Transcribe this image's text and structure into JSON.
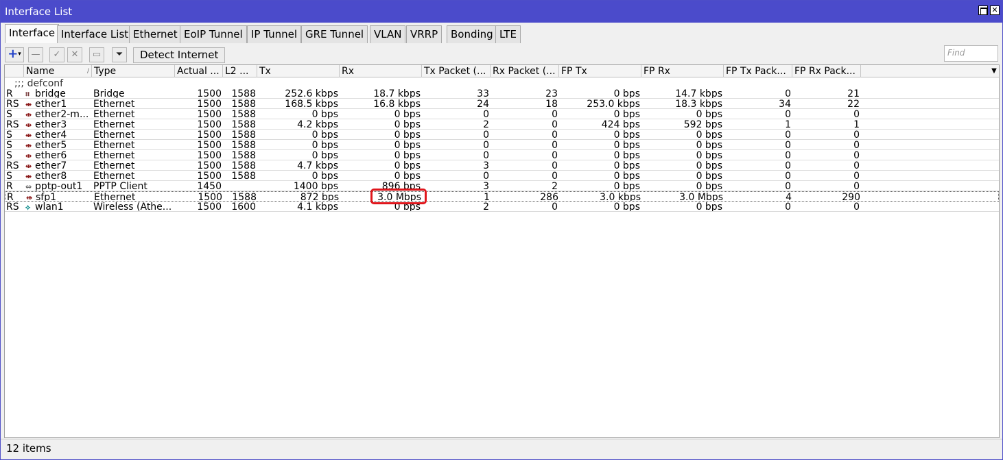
{
  "window": {
    "title": "Interface List"
  },
  "tabs": [
    "Interface",
    "Interface List",
    "Ethernet",
    "EoIP Tunnel",
    "IP Tunnel",
    "GRE Tunnel",
    "VLAN",
    "VRRP",
    "Bonding",
    "LTE"
  ],
  "toolbar": {
    "add_icon": "plus-icon",
    "remove_icon": "minus-icon",
    "enable_icon": "check-icon",
    "disable_icon": "x-icon",
    "comment_icon": "note-icon",
    "filter_icon": "funnel-icon",
    "detect_label": "Detect Internet",
    "find_placeholder": "Find"
  },
  "columns": [
    "Name",
    "Type",
    "Actual ...",
    "L2 ...",
    "Tx",
    "Rx",
    "Tx Packet (...",
    "Rx Packet (...",
    "FP Tx",
    "FP Rx",
    "FP Tx Pack...",
    "FP Rx Pack..."
  ],
  "comment_row": ";;; defconf",
  "rows": [
    {
      "flags": "R",
      "icon": "bridge-icon",
      "name": "bridge",
      "type": "Bridge",
      "actual": "1500",
      "l2": "1588",
      "tx": "252.6 kbps",
      "rx": "18.7 kbps",
      "txp": "33",
      "rxp": "23",
      "fptx": "0 bps",
      "fprx": "14.7 kbps",
      "fptxp": "0",
      "fprxp": "21"
    },
    {
      "flags": "RS",
      "icon": "ethernet-icon",
      "name": "ether1",
      "type": "Ethernet",
      "actual": "1500",
      "l2": "1588",
      "tx": "168.5 kbps",
      "rx": "16.8 kbps",
      "txp": "24",
      "rxp": "18",
      "fptx": "253.0 kbps",
      "fprx": "18.3 kbps",
      "fptxp": "34",
      "fprxp": "22"
    },
    {
      "flags": "S",
      "icon": "ethernet-icon",
      "name": "ether2-m...",
      "type": "Ethernet",
      "actual": "1500",
      "l2": "1588",
      "tx": "0 bps",
      "rx": "0 bps",
      "txp": "0",
      "rxp": "0",
      "fptx": "0 bps",
      "fprx": "0 bps",
      "fptxp": "0",
      "fprxp": "0"
    },
    {
      "flags": "RS",
      "icon": "ethernet-icon",
      "name": "ether3",
      "type": "Ethernet",
      "actual": "1500",
      "l2": "1588",
      "tx": "4.2 kbps",
      "rx": "0 bps",
      "txp": "2",
      "rxp": "0",
      "fptx": "424 bps",
      "fprx": "592 bps",
      "fptxp": "1",
      "fprxp": "1"
    },
    {
      "flags": "S",
      "icon": "ethernet-icon",
      "name": "ether4",
      "type": "Ethernet",
      "actual": "1500",
      "l2": "1588",
      "tx": "0 bps",
      "rx": "0 bps",
      "txp": "0",
      "rxp": "0",
      "fptx": "0 bps",
      "fprx": "0 bps",
      "fptxp": "0",
      "fprxp": "0"
    },
    {
      "flags": "S",
      "icon": "ethernet-icon",
      "name": "ether5",
      "type": "Ethernet",
      "actual": "1500",
      "l2": "1588",
      "tx": "0 bps",
      "rx": "0 bps",
      "txp": "0",
      "rxp": "0",
      "fptx": "0 bps",
      "fprx": "0 bps",
      "fptxp": "0",
      "fprxp": "0"
    },
    {
      "flags": "S",
      "icon": "ethernet-icon",
      "name": "ether6",
      "type": "Ethernet",
      "actual": "1500",
      "l2": "1588",
      "tx": "0 bps",
      "rx": "0 bps",
      "txp": "0",
      "rxp": "0",
      "fptx": "0 bps",
      "fprx": "0 bps",
      "fptxp": "0",
      "fprxp": "0"
    },
    {
      "flags": "RS",
      "icon": "ethernet-icon",
      "name": "ether7",
      "type": "Ethernet",
      "actual": "1500",
      "l2": "1588",
      "tx": "4.7 kbps",
      "rx": "0 bps",
      "txp": "3",
      "rxp": "0",
      "fptx": "0 bps",
      "fprx": "0 bps",
      "fptxp": "0",
      "fprxp": "0"
    },
    {
      "flags": "S",
      "icon": "ethernet-icon",
      "name": "ether8",
      "type": "Ethernet",
      "actual": "1500",
      "l2": "1588",
      "tx": "0 bps",
      "rx": "0 bps",
      "txp": "0",
      "rxp": "0",
      "fptx": "0 bps",
      "fprx": "0 bps",
      "fptxp": "0",
      "fprxp": "0"
    },
    {
      "flags": "R",
      "icon": "pptp-icon",
      "name": "pptp-out1",
      "type": "PPTP Client",
      "actual": "1450",
      "l2": "",
      "tx": "1400 bps",
      "rx": "896 bps",
      "txp": "3",
      "rxp": "2",
      "fptx": "0 bps",
      "fprx": "0 bps",
      "fptxp": "0",
      "fprxp": "0"
    },
    {
      "flags": "R",
      "icon": "ethernet-icon",
      "name": "sfp1",
      "type": "Ethernet",
      "actual": "1500",
      "l2": "1588",
      "tx": "872 bps",
      "rx": "3.0 Mbps",
      "txp": "1",
      "rxp": "286",
      "fptx": "3.0 kbps",
      "fprx": "3.0 Mbps",
      "fptxp": "4",
      "fprxp": "290"
    },
    {
      "flags": "RS",
      "icon": "wireless-icon",
      "name": "wlan1",
      "type": "Wireless (Athe...",
      "actual": "1500",
      "l2": "1600",
      "tx": "4.1 kbps",
      "rx": "0 bps",
      "txp": "2",
      "rxp": "0",
      "fptx": "0 bps",
      "fprx": "0 bps",
      "fptxp": "0",
      "fprxp": "0"
    }
  ],
  "status": {
    "count": "12 items"
  }
}
